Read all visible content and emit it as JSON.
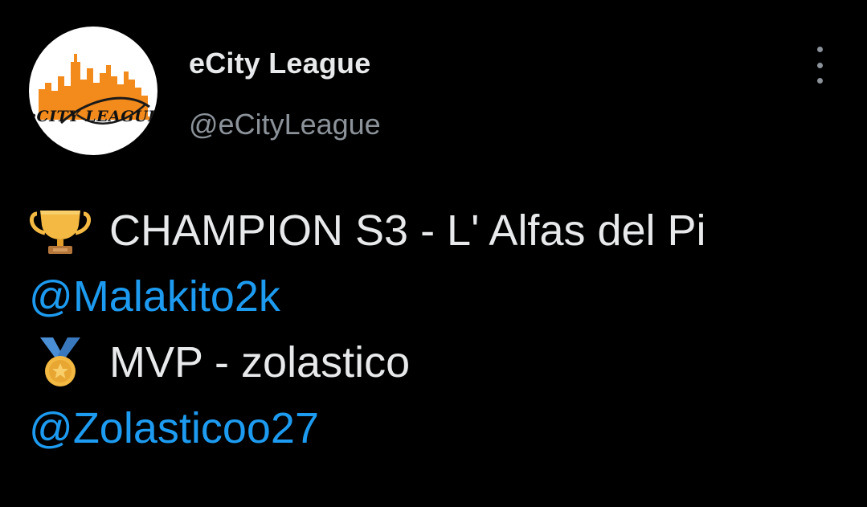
{
  "account": {
    "display_name": "eCity League",
    "handle": "@eCityLeague",
    "avatar_logo_text": "eCITY LEAGUE"
  },
  "tweet": {
    "line1_emoji": "trophy-icon",
    "line1_text": "CHAMPION S3 - L' Alfas del Pi",
    "line2_mention": "@Malakito2k",
    "line3_emoji": "medal-icon",
    "line3_text": "MVP - zolastico",
    "line4_mention": "@Zolasticoo27"
  },
  "colors": {
    "background": "#000000",
    "text": "#e7e9ea",
    "secondary": "#8b9299",
    "mention": "#1d9bf0",
    "logo_orange": "#f28a1c"
  }
}
